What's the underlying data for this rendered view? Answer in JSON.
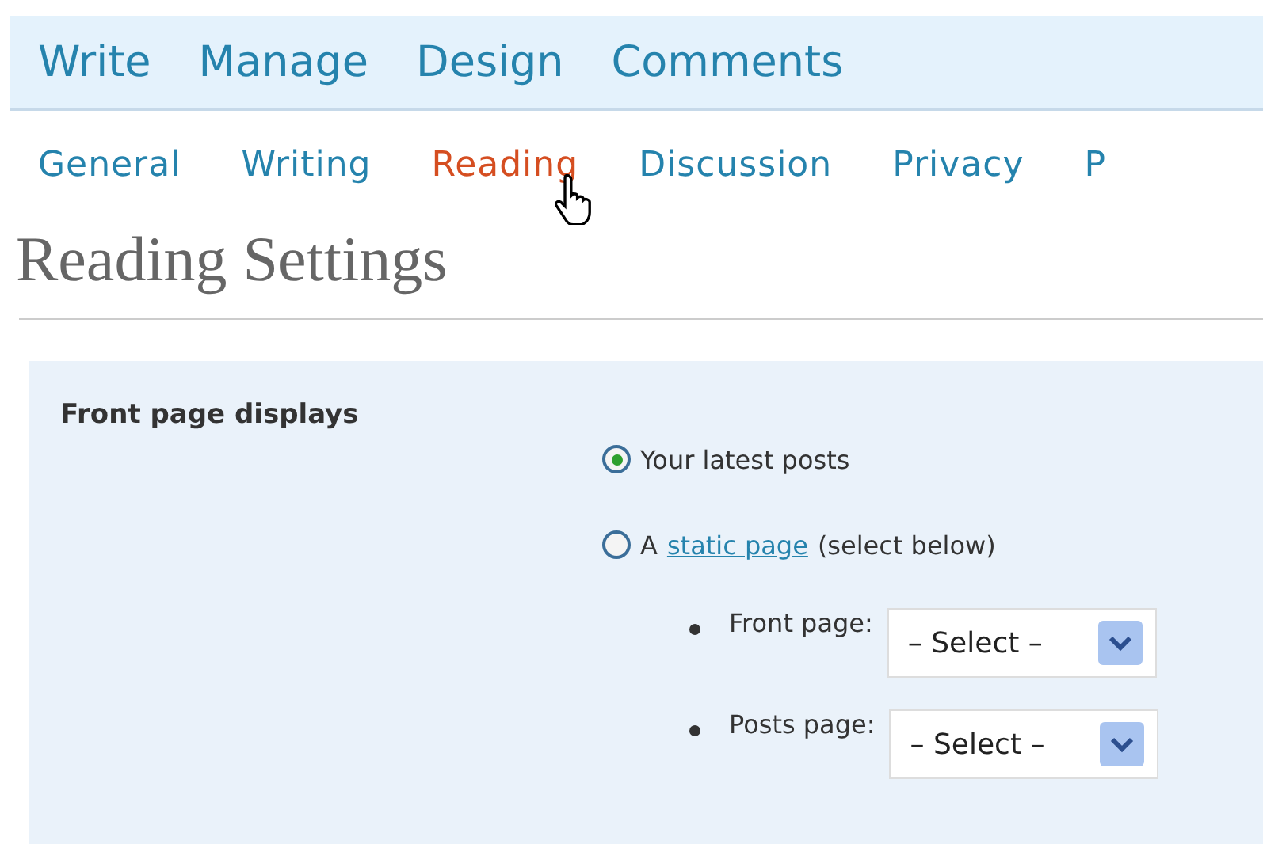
{
  "main_nav": [
    {
      "label": "Write"
    },
    {
      "label": "Manage"
    },
    {
      "label": "Design"
    },
    {
      "label": "Comments"
    }
  ],
  "sub_nav": [
    {
      "label": "General",
      "selected": false
    },
    {
      "label": "Writing",
      "selected": false
    },
    {
      "label": "Reading",
      "selected": true
    },
    {
      "label": "Discussion",
      "selected": false
    },
    {
      "label": "Privacy",
      "selected": false
    },
    {
      "label": "P",
      "selected": false
    }
  ],
  "heading": "Reading Settings",
  "front_page_displays": {
    "label": "Front page displays",
    "options": [
      {
        "text": "Your latest posts",
        "selected": true
      },
      {
        "prefix": "A",
        "link": "static page",
        "suffix": "(select below)",
        "selected": false
      }
    ],
    "selects": [
      {
        "label": "Front page:",
        "value": "– Select –"
      },
      {
        "label": "Posts page:",
        "value": "– Select –"
      }
    ]
  }
}
